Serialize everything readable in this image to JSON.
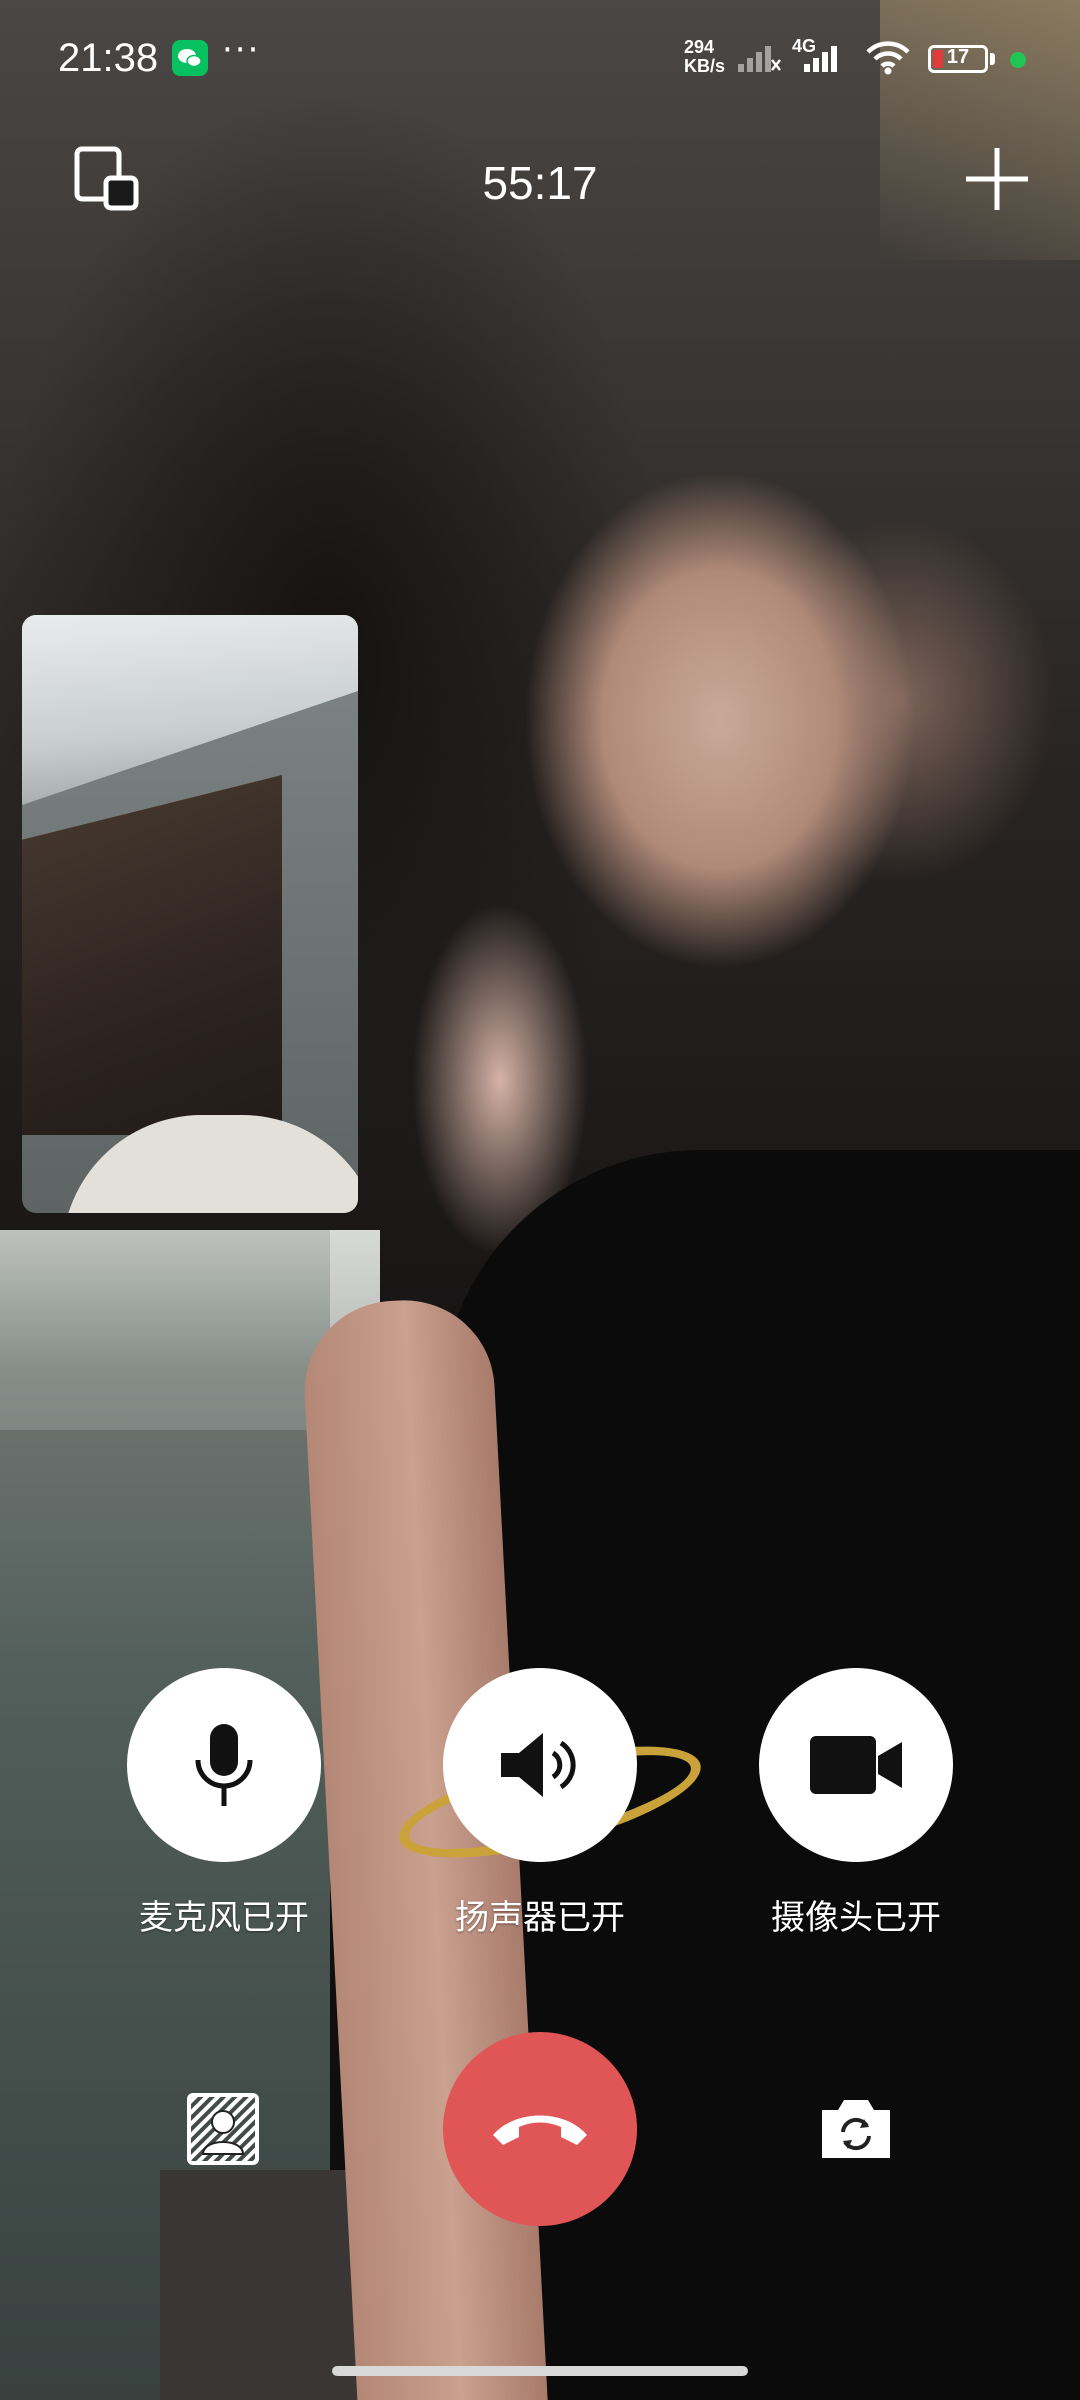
{
  "status_bar": {
    "time": "21:38",
    "net_speed_value": "294",
    "net_speed_unit": "KB/s",
    "network_type": "4G",
    "battery_level": "17",
    "colors": {
      "wechat_green": "#07c160",
      "battery_low": "#e03a3a",
      "charging_dot": "#23c552"
    }
  },
  "call": {
    "duration": "55:17"
  },
  "controls": {
    "microphone_label": "麦克风已开",
    "speaker_label": "扬声器已开",
    "camera_label": "摄像头已开"
  },
  "icons": {
    "switch_window": "switch-window-icon",
    "add": "plus-icon",
    "microphone": "microphone-icon",
    "speaker": "speaker-icon",
    "camera": "video-camera-icon",
    "background_blur": "blur-background-icon",
    "hang_up": "phone-hangup-icon",
    "flip_camera": "flip-camera-icon"
  },
  "colors": {
    "hangup_red": "#e05555",
    "control_circle": "#ffffff"
  }
}
